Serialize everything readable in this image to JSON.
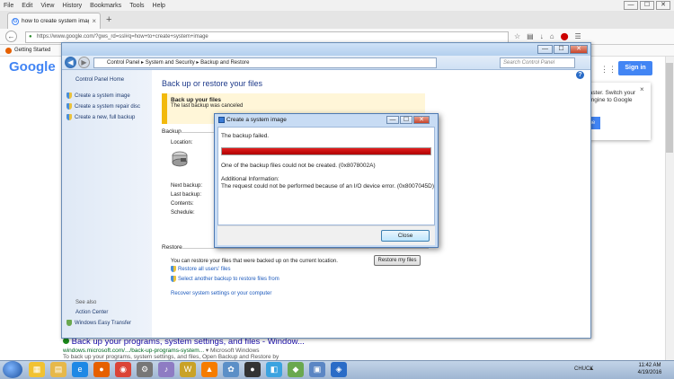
{
  "firefox": {
    "menu": [
      "File",
      "Edit",
      "View",
      "History",
      "Bookmarks",
      "Tools",
      "Help"
    ],
    "tab_title": "how to create system imag...",
    "tab_close": "×",
    "new_tab": "+",
    "url": "https://www.google.com/?gws_rd=ssl#q=how+to+create+system+image",
    "bookmark": "Getting Started",
    "win_controls": [
      "—",
      "☐",
      "✕"
    ]
  },
  "google": {
    "logo": "Google",
    "sign_in": "Sign in",
    "popup_text": "faster. Switch your engine to Google",
    "popup_close": "×",
    "popup_button": "me",
    "result_title": "Back up your programs, system settings, and files - Window...",
    "result_url": "windows.microsoft.com/.../back-up-programs-system...",
    "result_source": " ▾ Microsoft Windows",
    "result_snippet": "To back up your programs, system settings, and files, Open Backup and Restore by"
  },
  "control_panel": {
    "breadcrumb": [
      "Control Panel",
      "System and Security",
      "Backup and Restore"
    ],
    "search_placeholder": "Search Control Panel",
    "help": "?",
    "sidebar_home": "Control Panel Home",
    "sidebar_links": [
      "Create a system image",
      "Create a system repair disc",
      "Create a new, full backup"
    ],
    "see_also_heading": "See also",
    "see_also_links": [
      "Action Center",
      "Windows Easy Transfer"
    ],
    "main_title": "Back up or restore your files",
    "banner_title": "Back up your files",
    "banner_subtitle": "The last backup was canceled",
    "backup_heading": "Backup",
    "location_label": "Location:",
    "backup_labels": [
      "Next backup:",
      "Last backup:",
      "Contents:",
      "Schedule:"
    ],
    "restore_heading": "Restore",
    "restore_text": "You can restore your files that were backed up on the current location.",
    "restore_button": "Restore my files",
    "restore_links": [
      "Restore all users' files",
      "Select another backup to restore files from"
    ],
    "recover_link": "Recover system settings or your computer"
  },
  "dialog": {
    "title": "Create a system image",
    "status": "The backup failed.",
    "progress": 1.0,
    "progress_color": "#cc0000",
    "error_line": "One of the backup files could not be created. (0x8078002A)",
    "additional_label": "Additional Information:",
    "additional_detail": "The request could not be performed because of an I/O device error. (0x8007045D)",
    "close_button": "Close"
  },
  "taskbar": {
    "user": "CHUCK",
    "time": "11:42 AM",
    "date": "4/19/2016",
    "icons": [
      "explorer-icon",
      "folder-icon",
      "ie-icon",
      "firefox-icon",
      "chrome-icon",
      "backup-icon",
      "media-icon",
      "word-icon",
      "vlc-icon",
      "settings-icon",
      "camera-icon",
      "video-icon",
      "network-icon",
      "control-panel-icon",
      "system-image-icon"
    ]
  }
}
